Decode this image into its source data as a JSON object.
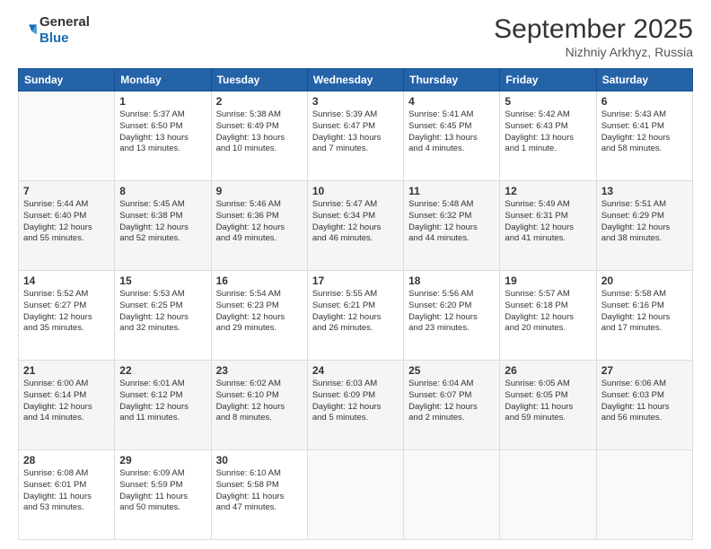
{
  "header": {
    "logo_general": "General",
    "logo_blue": "Blue",
    "month": "September 2025",
    "location": "Nizhniy Arkhyz, Russia"
  },
  "weekdays": [
    "Sunday",
    "Monday",
    "Tuesday",
    "Wednesday",
    "Thursday",
    "Friday",
    "Saturday"
  ],
  "weeks": [
    [
      {
        "day": "",
        "info": ""
      },
      {
        "day": "1",
        "info": "Sunrise: 5:37 AM\nSunset: 6:50 PM\nDaylight: 13 hours\nand 13 minutes."
      },
      {
        "day": "2",
        "info": "Sunrise: 5:38 AM\nSunset: 6:49 PM\nDaylight: 13 hours\nand 10 minutes."
      },
      {
        "day": "3",
        "info": "Sunrise: 5:39 AM\nSunset: 6:47 PM\nDaylight: 13 hours\nand 7 minutes."
      },
      {
        "day": "4",
        "info": "Sunrise: 5:41 AM\nSunset: 6:45 PM\nDaylight: 13 hours\nand 4 minutes."
      },
      {
        "day": "5",
        "info": "Sunrise: 5:42 AM\nSunset: 6:43 PM\nDaylight: 13 hours\nand 1 minute."
      },
      {
        "day": "6",
        "info": "Sunrise: 5:43 AM\nSunset: 6:41 PM\nDaylight: 12 hours\nand 58 minutes."
      }
    ],
    [
      {
        "day": "7",
        "info": "Sunrise: 5:44 AM\nSunset: 6:40 PM\nDaylight: 12 hours\nand 55 minutes."
      },
      {
        "day": "8",
        "info": "Sunrise: 5:45 AM\nSunset: 6:38 PM\nDaylight: 12 hours\nand 52 minutes."
      },
      {
        "day": "9",
        "info": "Sunrise: 5:46 AM\nSunset: 6:36 PM\nDaylight: 12 hours\nand 49 minutes."
      },
      {
        "day": "10",
        "info": "Sunrise: 5:47 AM\nSunset: 6:34 PM\nDaylight: 12 hours\nand 46 minutes."
      },
      {
        "day": "11",
        "info": "Sunrise: 5:48 AM\nSunset: 6:32 PM\nDaylight: 12 hours\nand 44 minutes."
      },
      {
        "day": "12",
        "info": "Sunrise: 5:49 AM\nSunset: 6:31 PM\nDaylight: 12 hours\nand 41 minutes."
      },
      {
        "day": "13",
        "info": "Sunrise: 5:51 AM\nSunset: 6:29 PM\nDaylight: 12 hours\nand 38 minutes."
      }
    ],
    [
      {
        "day": "14",
        "info": "Sunrise: 5:52 AM\nSunset: 6:27 PM\nDaylight: 12 hours\nand 35 minutes."
      },
      {
        "day": "15",
        "info": "Sunrise: 5:53 AM\nSunset: 6:25 PM\nDaylight: 12 hours\nand 32 minutes."
      },
      {
        "day": "16",
        "info": "Sunrise: 5:54 AM\nSunset: 6:23 PM\nDaylight: 12 hours\nand 29 minutes."
      },
      {
        "day": "17",
        "info": "Sunrise: 5:55 AM\nSunset: 6:21 PM\nDaylight: 12 hours\nand 26 minutes."
      },
      {
        "day": "18",
        "info": "Sunrise: 5:56 AM\nSunset: 6:20 PM\nDaylight: 12 hours\nand 23 minutes."
      },
      {
        "day": "19",
        "info": "Sunrise: 5:57 AM\nSunset: 6:18 PM\nDaylight: 12 hours\nand 20 minutes."
      },
      {
        "day": "20",
        "info": "Sunrise: 5:58 AM\nSunset: 6:16 PM\nDaylight: 12 hours\nand 17 minutes."
      }
    ],
    [
      {
        "day": "21",
        "info": "Sunrise: 6:00 AM\nSunset: 6:14 PM\nDaylight: 12 hours\nand 14 minutes."
      },
      {
        "day": "22",
        "info": "Sunrise: 6:01 AM\nSunset: 6:12 PM\nDaylight: 12 hours\nand 11 minutes."
      },
      {
        "day": "23",
        "info": "Sunrise: 6:02 AM\nSunset: 6:10 PM\nDaylight: 12 hours\nand 8 minutes."
      },
      {
        "day": "24",
        "info": "Sunrise: 6:03 AM\nSunset: 6:09 PM\nDaylight: 12 hours\nand 5 minutes."
      },
      {
        "day": "25",
        "info": "Sunrise: 6:04 AM\nSunset: 6:07 PM\nDaylight: 12 hours\nand 2 minutes."
      },
      {
        "day": "26",
        "info": "Sunrise: 6:05 AM\nSunset: 6:05 PM\nDaylight: 11 hours\nand 59 minutes."
      },
      {
        "day": "27",
        "info": "Sunrise: 6:06 AM\nSunset: 6:03 PM\nDaylight: 11 hours\nand 56 minutes."
      }
    ],
    [
      {
        "day": "28",
        "info": "Sunrise: 6:08 AM\nSunset: 6:01 PM\nDaylight: 11 hours\nand 53 minutes."
      },
      {
        "day": "29",
        "info": "Sunrise: 6:09 AM\nSunset: 5:59 PM\nDaylight: 11 hours\nand 50 minutes."
      },
      {
        "day": "30",
        "info": "Sunrise: 6:10 AM\nSunset: 5:58 PM\nDaylight: 11 hours\nand 47 minutes."
      },
      {
        "day": "",
        "info": ""
      },
      {
        "day": "",
        "info": ""
      },
      {
        "day": "",
        "info": ""
      },
      {
        "day": "",
        "info": ""
      }
    ]
  ]
}
